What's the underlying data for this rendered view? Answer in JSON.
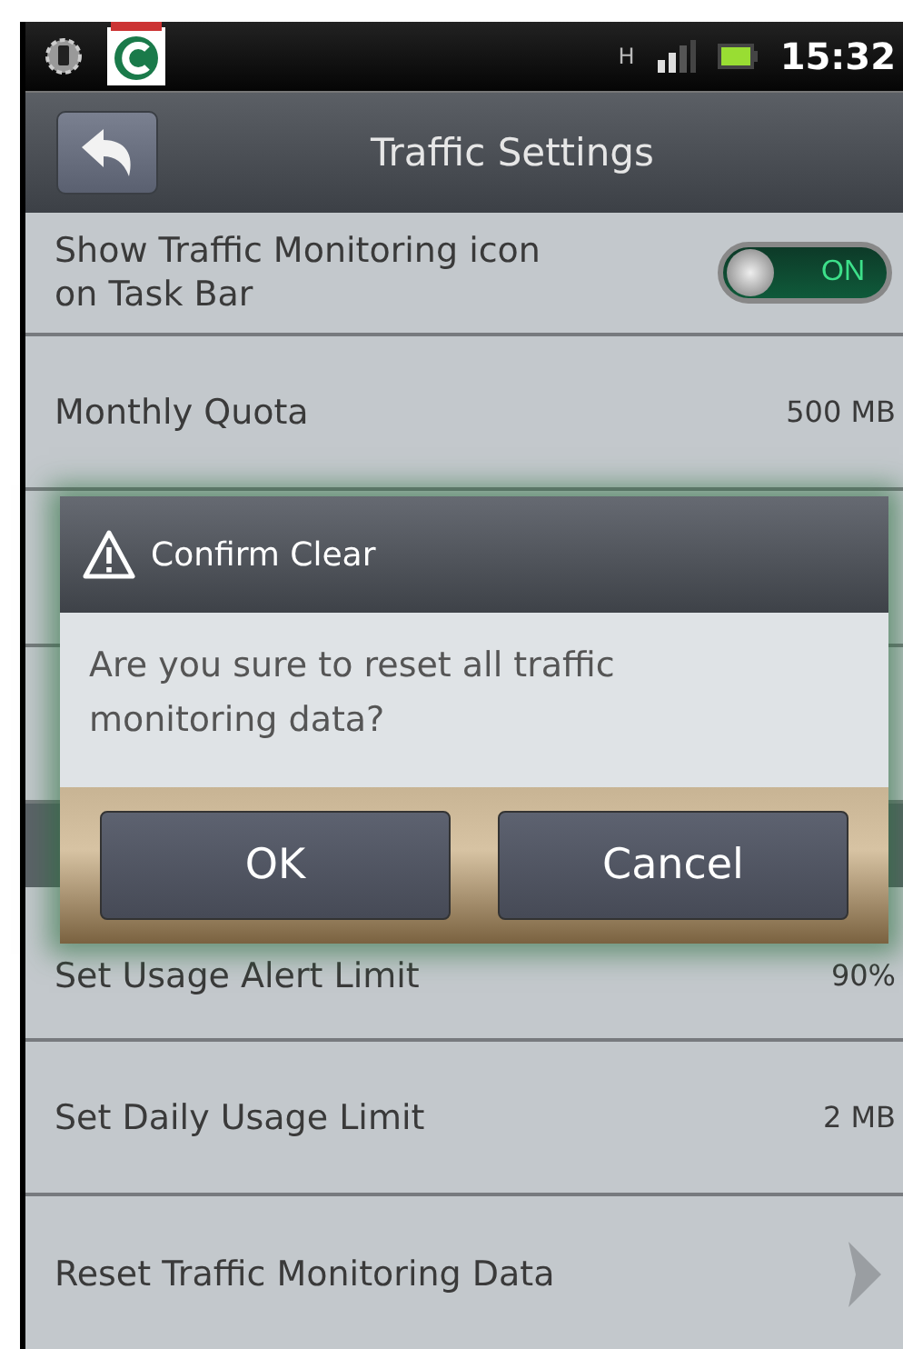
{
  "status_bar": {
    "network": "H",
    "time": "15:32"
  },
  "title": "Traffic Settings",
  "settings": [
    {
      "kind": "toggle",
      "label": "Show Traffic Monitoring icon on Task Bar",
      "on": true,
      "toggle_label": "ON"
    },
    {
      "kind": "value",
      "label": "Monthly Quota",
      "value": "500 MB"
    },
    {
      "kind": "covered"
    },
    {
      "kind": "covered"
    },
    {
      "kind": "covered-header"
    },
    {
      "kind": "value",
      "label": "Set Usage Alert Limit",
      "value": "90%"
    },
    {
      "kind": "value",
      "label": "Set Daily Usage Limit",
      "value": "2 MB"
    },
    {
      "kind": "link",
      "label": "Reset Traffic Monitoring Data"
    }
  ],
  "dialog": {
    "title": "Confirm Clear",
    "message": "Are you sure to reset all traffic monitoring data?",
    "buttons": [
      "OK",
      "Cancel"
    ]
  }
}
